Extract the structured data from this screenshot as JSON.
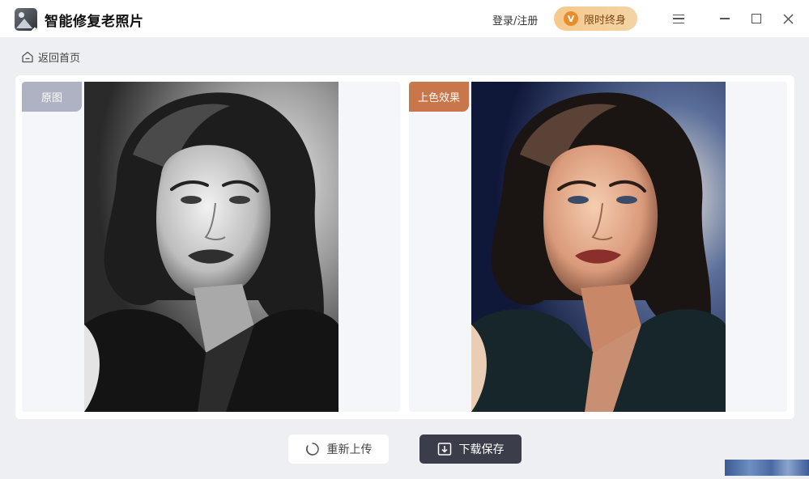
{
  "app": {
    "title": "智能修复老照片",
    "login_label": "登录/注册",
    "vip_label": "限时终身",
    "vip_icon_text": "V"
  },
  "icons": {
    "logo": "app-logo-icon",
    "vip": "diamond-icon",
    "menu": "menu-icon",
    "minimize": "minimize-icon",
    "maximize": "maximize-icon",
    "close": "close-icon",
    "home": "home-icon",
    "reupload": "refresh-icon",
    "download": "download-icon"
  },
  "nav": {
    "back_label": "返回首页"
  },
  "panes": {
    "original_tag": "原图",
    "colored_tag": "上色效果"
  },
  "actions": {
    "reupload_label": "重新上传",
    "download_label": "下载保存"
  },
  "colors": {
    "original_tag": "#aeb2c2",
    "colored_tag": "#c9774a",
    "vip_gradient_start": "#f6c98d",
    "download_button": "#3b3e4a"
  }
}
